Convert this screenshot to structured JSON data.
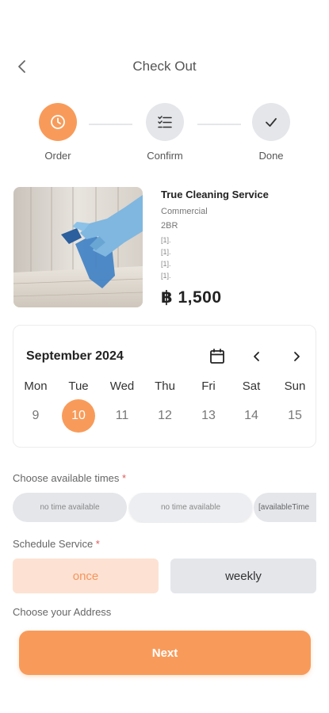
{
  "header": {
    "title": "Check Out",
    "back_icon": "chevron-left-icon"
  },
  "stepper": {
    "steps": [
      {
        "label": "Order",
        "icon": "clock-icon",
        "state": "active"
      },
      {
        "label": "Confirm",
        "icon": "checklist-icon",
        "state": "inactive"
      },
      {
        "label": "Done",
        "icon": "check-icon",
        "state": "inactive"
      }
    ]
  },
  "service": {
    "title": "True Cleaning Service",
    "type": "Commercial",
    "size": "2BR",
    "details": [
      "[1].",
      "[1].",
      "[1].",
      "[1]."
    ],
    "price": "฿ 1,500"
  },
  "calendar": {
    "month": "September 2024",
    "weekdays": [
      "Mon",
      "Tue",
      "Wed",
      "Thu",
      "Fri",
      "Sat",
      "Sun"
    ],
    "days": [
      "9",
      "10",
      "11",
      "12",
      "13",
      "14",
      "15"
    ],
    "selected_day": "10",
    "icons": [
      "calendar-icon",
      "chevron-left-icon",
      "chevron-right-icon"
    ]
  },
  "times": {
    "label": "Choose available times",
    "required_mark": "*",
    "slots": [
      "no time available",
      "no time available"
    ],
    "overflow_text": "[availableTime"
  },
  "schedule": {
    "label": "Schedule Service",
    "required_mark": "*",
    "options": [
      "once",
      "weekly"
    ],
    "selected": "once"
  },
  "address": {
    "label": "Choose your Address"
  },
  "next_label": "Next",
  "colors": {
    "accent": "#f89b5a",
    "accent_light": "#fde2d3",
    "neutral": "#e4e6ea"
  }
}
